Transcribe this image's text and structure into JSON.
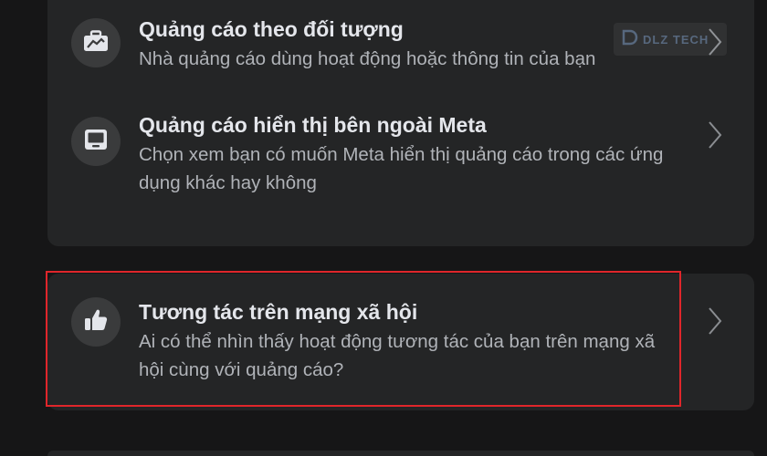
{
  "items": [
    {
      "title": "Quảng cáo theo đối tượng",
      "description": "Nhà quảng cáo dùng hoạt động hoặc thông tin của bạn",
      "icon": "briefcase-icon"
    },
    {
      "title": "Quảng cáo hiển thị bên ngoài Meta",
      "description": "Chọn xem bạn có muốn Meta hiển thị quảng cáo trong các ứng dụng khác hay không",
      "icon": "laptop-icon"
    },
    {
      "title": "Tương tác trên mạng xã hội",
      "description": "Ai có thể nhìn thấy hoạt động tương tác của bạn trên mạng xã hội cùng với quảng cáo?",
      "icon": "thumbs-up-icon"
    }
  ],
  "watermark": {
    "text": "DLZ TECH"
  },
  "colors": {
    "background": "#161617",
    "card": "#242526",
    "icon_circle": "#3a3b3c",
    "title": "#e4e6eb",
    "description": "#b0b3b8",
    "highlight": "#e0262b"
  }
}
